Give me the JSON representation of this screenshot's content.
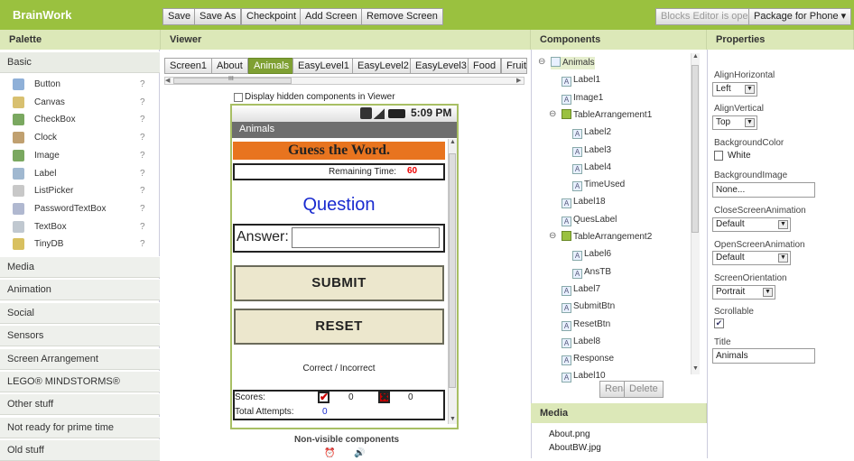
{
  "app": {
    "brand": "BrainWork"
  },
  "toolbar": {
    "save": "Save",
    "save_as": "Save As",
    "checkpoint": "Checkpoint",
    "add_screen": "Add Screen",
    "remove_screen": "Remove Screen",
    "blocks_editor": "Blocks Editor is open",
    "package": "Package for Phone ▾"
  },
  "headers": {
    "palette": "Palette",
    "viewer": "Viewer",
    "components": "Components",
    "properties": "Properties",
    "media": "Media"
  },
  "palette": {
    "basic": "Basic",
    "items": [
      {
        "label": "Button",
        "icon": "button-icon"
      },
      {
        "label": "Canvas",
        "icon": "canvas-icon"
      },
      {
        "label": "CheckBox",
        "icon": "checkbox-icon"
      },
      {
        "label": "Clock",
        "icon": "clock-icon"
      },
      {
        "label": "Image",
        "icon": "image-icon"
      },
      {
        "label": "Label",
        "icon": "label-icon"
      },
      {
        "label": "ListPicker",
        "icon": "listpicker-icon"
      },
      {
        "label": "PasswordTextBox",
        "icon": "password-icon"
      },
      {
        "label": "TextBox",
        "icon": "textbox-icon"
      },
      {
        "label": "TinyDB",
        "icon": "database-icon"
      }
    ],
    "help": "?",
    "categories": [
      "Media",
      "Animation",
      "Social",
      "Sensors",
      "Screen Arrangement",
      "LEGO® MINDSTORMS®",
      "Other stuff",
      "Not ready for prime time",
      "Old stuff"
    ]
  },
  "viewer": {
    "tabs": [
      "Screen1",
      "About",
      "Animals",
      "EasyLevel1",
      "EasyLevel2",
      "EasyLevel3",
      "Food",
      "Fruit"
    ],
    "active_tab": "Animals",
    "hidden_checkbox": "Display hidden components in Viewer",
    "scroll_mid": "III",
    "phone": {
      "time": "5:09 PM",
      "title": "Animals",
      "banner": "Guess the Word.",
      "remaining_label": "Remaining Time:",
      "remaining_value": "60",
      "question": "Question",
      "answer_label": "Answer:",
      "submit": "SUBMIT",
      "reset": "RESET",
      "result": "Correct / Incorrect",
      "scores_label": "Scores:",
      "score_correct": "0",
      "score_wrong": "0",
      "attempts_label": "Total Attempts:",
      "attempts_value": "0"
    },
    "nonvisible": "Non-visible components"
  },
  "components": {
    "tree": [
      {
        "name": "Animals",
        "level": 0
      },
      {
        "name": "Label1",
        "level": 1
      },
      {
        "name": "Image1",
        "level": 1
      },
      {
        "name": "TableArrangement1",
        "level": 1
      },
      {
        "name": "Label2",
        "level": 2
      },
      {
        "name": "Label3",
        "level": 2
      },
      {
        "name": "Label4",
        "level": 2
      },
      {
        "name": "TimeUsed",
        "level": 2
      },
      {
        "name": "Label18",
        "level": 1
      },
      {
        "name": "QuesLabel",
        "level": 1
      },
      {
        "name": "TableArrangement2",
        "level": 1
      },
      {
        "name": "Label6",
        "level": 2
      },
      {
        "name": "AnsTB",
        "level": 2
      },
      {
        "name": "Label7",
        "level": 1
      },
      {
        "name": "SubmitBtn",
        "level": 1
      },
      {
        "name": "ResetBtn",
        "level": 1
      },
      {
        "name": "Label8",
        "level": 1
      },
      {
        "name": "Response",
        "level": 1
      },
      {
        "name": "Label10",
        "level": 1
      }
    ],
    "rename": "Rename",
    "delete": "Delete",
    "media": [
      "About.png",
      "AboutBW.jpg"
    ]
  },
  "properties": {
    "align_h_label": "AlignHorizontal",
    "align_h": "Left",
    "align_v_label": "AlignVertical",
    "align_v": "Top",
    "bg_color_label": "BackgroundColor",
    "bg_color": "White",
    "bg_image_label": "BackgroundImage",
    "bg_image": "None...",
    "close_anim_label": "CloseScreenAnimation",
    "close_anim": "Default",
    "open_anim_label": "OpenScreenAnimation",
    "open_anim": "Default",
    "orientation_label": "ScreenOrientation",
    "orientation": "Portrait",
    "scrollable_label": "Scrollable",
    "title_label": "Title",
    "title": "Animals"
  }
}
